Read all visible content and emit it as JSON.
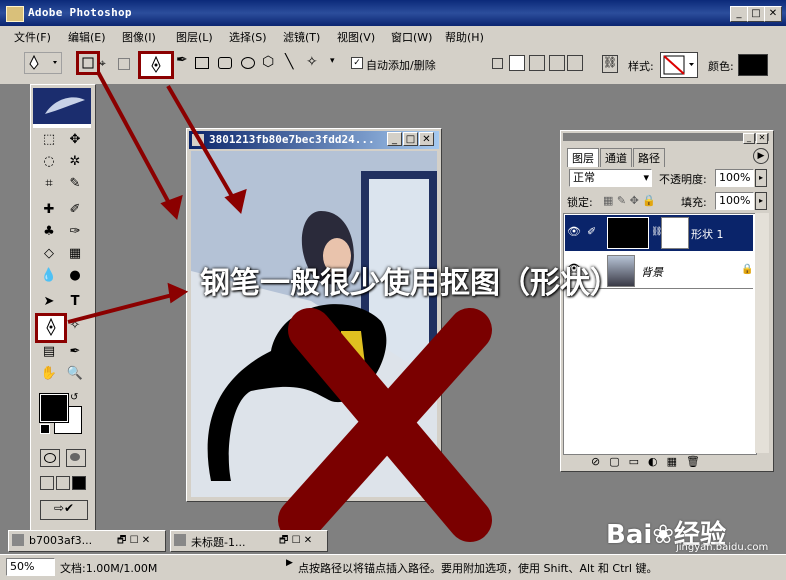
{
  "app": {
    "title": "Adobe Photoshop"
  },
  "window_controls": {
    "minimize": "_",
    "maximize": "□",
    "close": "✕"
  },
  "menu": [
    "文件(F)",
    "编辑(E)",
    "图像(I)",
    "图层(L)",
    "选择(S)",
    "滤镜(T)",
    "视图(V)",
    "窗口(W)",
    "帮助(H)"
  ],
  "options_bar": {
    "auto_add_delete_label": "自动添加/删除",
    "auto_add_delete_checked": true,
    "style_label": "样式:",
    "color_label": "颜色:",
    "color_value": "#000000"
  },
  "document": {
    "title": "3801213fb80e7bec3fdd24..."
  },
  "overlay": {
    "caption": "钢笔一般很少使用抠图（形状）"
  },
  "layers_panel": {
    "tabs": [
      "图层",
      "通道",
      "路径"
    ],
    "blend_mode": "正常",
    "opacity_label": "不透明度:",
    "opacity_value": "100%",
    "lock_label": "锁定:",
    "fill_label": "填充:",
    "fill_value": "100%",
    "layers": [
      {
        "name": "形状 1",
        "selected": true
      },
      {
        "name": "背景",
        "selected": false
      }
    ]
  },
  "taskbar": {
    "items": [
      "b7003af3...",
      "未标题-1..."
    ]
  },
  "status": {
    "zoom": "50%",
    "doc_size": "文档:1.00M/1.00M",
    "hint": "点按路径以将锚点插入路径。要用附加选项，使用 Shift、Alt 和 Ctrl 键。"
  },
  "watermark": {
    "brand": "Bai❀经验",
    "url": "jingyan.baidu.com"
  },
  "colors": {
    "highlight": "#8b0000",
    "titlebar": "#0a246a",
    "x_mark": "#7a0000"
  }
}
